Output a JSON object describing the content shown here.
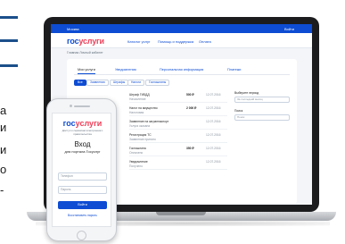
{
  "side_text": [
    "а",
    "и",
    "и",
    "о",
    "-"
  ],
  "desktop": {
    "topbar_left": "Москва",
    "topbar_right": "Войти",
    "logo_part1": "гос",
    "logo_part2": "услуги",
    "nav": [
      "Каталог услуг",
      "Помощь и поддержка",
      "Оплата"
    ],
    "breadcrumb": "Главная   Личный кабинет",
    "tabs": [
      "Мои услуги",
      "Уведомления",
      "Персональная информация",
      "Платежи"
    ],
    "chips": [
      "Все",
      "Заявления",
      "Штрафы",
      "Налоги",
      "Госпошлины"
    ],
    "rows": [
      {
        "title": "Штраф ГИБДД",
        "sub": "Начисление",
        "amount": "500 ₽",
        "date": "12.07.2016"
      },
      {
        "title": "Налог на имущество",
        "sub": "Налоговая",
        "amount": "2 000 ₽",
        "date": "12.07.2016"
      },
      {
        "title": "Заявление на загранпаспорт",
        "sub": "Услуга оказана",
        "amount": "",
        "date": "12.07.2016"
      },
      {
        "title": "Регистрация ТС",
        "sub": "Заявление принято",
        "amount": "",
        "date": "12.07.2016"
      },
      {
        "title": "Госпошлина",
        "sub": "Оплачено",
        "amount": "350 ₽",
        "date": "12.07.2016"
      },
      {
        "title": "Уведомление",
        "sub": "Получено",
        "amount": "",
        "date": "12.07.2016"
      }
    ],
    "filter": {
      "title": "Выберите период",
      "period": "За последний месяц",
      "search_label": "Поиск",
      "search_placeholder": "Поиск"
    }
  },
  "mobile": {
    "logo_part1": "гос",
    "logo_part2": "услуги",
    "subtitle": "Доступ к сервисам электронного правительства",
    "title": "Вход",
    "note": "для портала Госуслуг",
    "phone_placeholder": "Телефон",
    "password_placeholder": "Пароль",
    "login_button": "Войти",
    "restore_link": "Восстановить пароль"
  }
}
